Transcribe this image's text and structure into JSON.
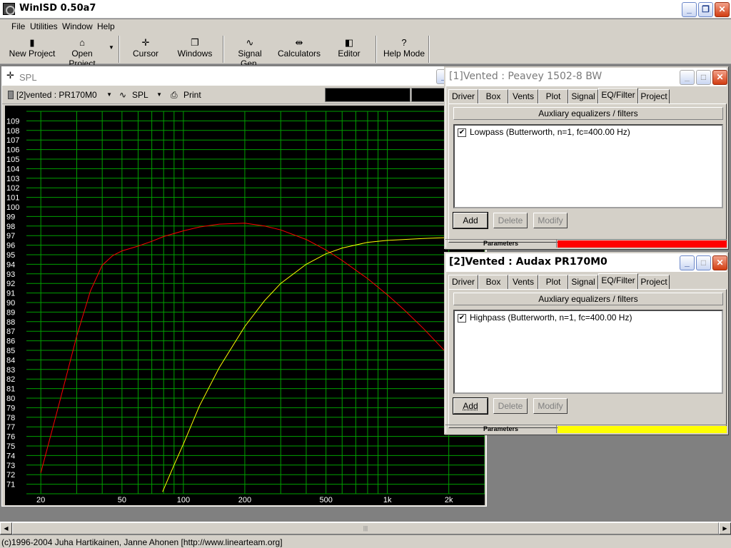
{
  "app": {
    "title": "WinISD 0.50a7"
  },
  "menu": [
    "File",
    "Utilities",
    "Window",
    "Help"
  ],
  "toolbar": [
    {
      "label": "New Project",
      "icon": "new-project-icon",
      "glyph": "▮"
    },
    {
      "label": "Open Project",
      "icon": "open-folder-icon",
      "glyph": "⌂"
    },
    {
      "label": "Cursor",
      "icon": "crosshair-icon",
      "glyph": "✛"
    },
    {
      "label": "Windows",
      "icon": "windows-icon",
      "glyph": "❐"
    },
    {
      "label": "Signal Gen.",
      "icon": "sine-wave-icon",
      "glyph": "∿"
    },
    {
      "label": "Calculators",
      "icon": "calculator-icon",
      "glyph": "⇹"
    },
    {
      "label": "Editor",
      "icon": "editor-icon",
      "glyph": "◧"
    },
    {
      "label": "Help Mode",
      "icon": "help-icon",
      "glyph": "?"
    }
  ],
  "spl": {
    "title": "SPL",
    "project_select": "[2]vented : PR170M0",
    "graph_select": "SPL",
    "print_label": "Print"
  },
  "windows": [
    {
      "title": "[1]Vented : Peavey 1502-8 BW",
      "tabs": [
        "Driver",
        "Box",
        "Vents",
        "Plot",
        "Signal",
        "EQ/Filter",
        "Project"
      ],
      "active_tab": "EQ/Filter",
      "aux_label": "Auxliary equalizers / filters",
      "filter": "Lowpass (Butterworth, n=1, fc=400.00 Hz)",
      "checked": true,
      "buttons": {
        "add": "Add",
        "delete": "Delete",
        "modify": "Modify"
      },
      "params_label": "Parameters",
      "params_color": "#ff0000"
    },
    {
      "title": "[2]Vented : Audax PR170M0",
      "tabs": [
        "Driver",
        "Box",
        "Vents",
        "Plot",
        "Signal",
        "EQ/Filter",
        "Project"
      ],
      "active_tab": "EQ/Filter",
      "aux_label": "Auxliary equalizers / filters",
      "filter": "Highpass (Butterworth, n=1, fc=400.00 Hz)",
      "checked": true,
      "buttons": {
        "add": "Add",
        "delete": "Delete",
        "modify": "Modify"
      },
      "params_label": "Parameters",
      "params_color": "#ffff00"
    }
  ],
  "status": "(c)1996-2004 Juha Hartikainen, Janne Ahonen [http://www.linearteam.org]",
  "chart_data": {
    "type": "line",
    "title": "",
    "xlabel": "",
    "ylabel": "",
    "x_scale": "log",
    "xlim": [
      17,
      3000
    ],
    "ylim": [
      70,
      110
    ],
    "x_tick_labels": [
      "20",
      "50",
      "100",
      "200",
      "500",
      "1k",
      "2k"
    ],
    "x_ticks": [
      20,
      50,
      100,
      200,
      500,
      1000,
      2000
    ],
    "y_ticks": [
      71,
      72,
      73,
      74,
      75,
      76,
      77,
      78,
      79,
      80,
      81,
      82,
      83,
      84,
      85,
      86,
      87,
      88,
      89,
      90,
      91,
      92,
      93,
      94,
      95,
      96,
      97,
      98,
      99,
      100,
      101,
      102,
      103,
      104,
      105,
      106,
      107,
      108,
      109
    ],
    "grid": true,
    "background": "#000000",
    "grid_color": "#00a000",
    "series": [
      {
        "color": "#ff0000",
        "x": [
          20,
          25,
          30,
          35,
          40,
          45,
          50,
          60,
          70,
          80,
          100,
          120,
          150,
          200,
          250,
          300,
          400,
          500,
          600,
          800,
          1000,
          1200,
          1500,
          2000,
          2500,
          2800
        ],
        "y": [
          72.2,
          80,
          86.5,
          91.2,
          93.9,
          94.9,
          95.4,
          95.9,
          96.4,
          96.9,
          97.5,
          97.9,
          98.2,
          98.3,
          98.0,
          97.6,
          96.6,
          95.5,
          94.4,
          92.5,
          90.8,
          89.3,
          87.3,
          84.5,
          82.2,
          81.0
        ]
      },
      {
        "color": "#ffff00",
        "x": [
          79,
          90,
          100,
          120,
          150,
          200,
          250,
          300,
          400,
          500,
          600,
          800,
          1000,
          1500,
          2000,
          2500,
          3000
        ],
        "y": [
          70.2,
          73.0,
          75.2,
          79.2,
          83.2,
          87.5,
          90.2,
          92.0,
          94.0,
          95.1,
          95.7,
          96.3,
          96.5,
          96.7,
          96.8,
          96.9,
          96.9
        ]
      }
    ]
  }
}
